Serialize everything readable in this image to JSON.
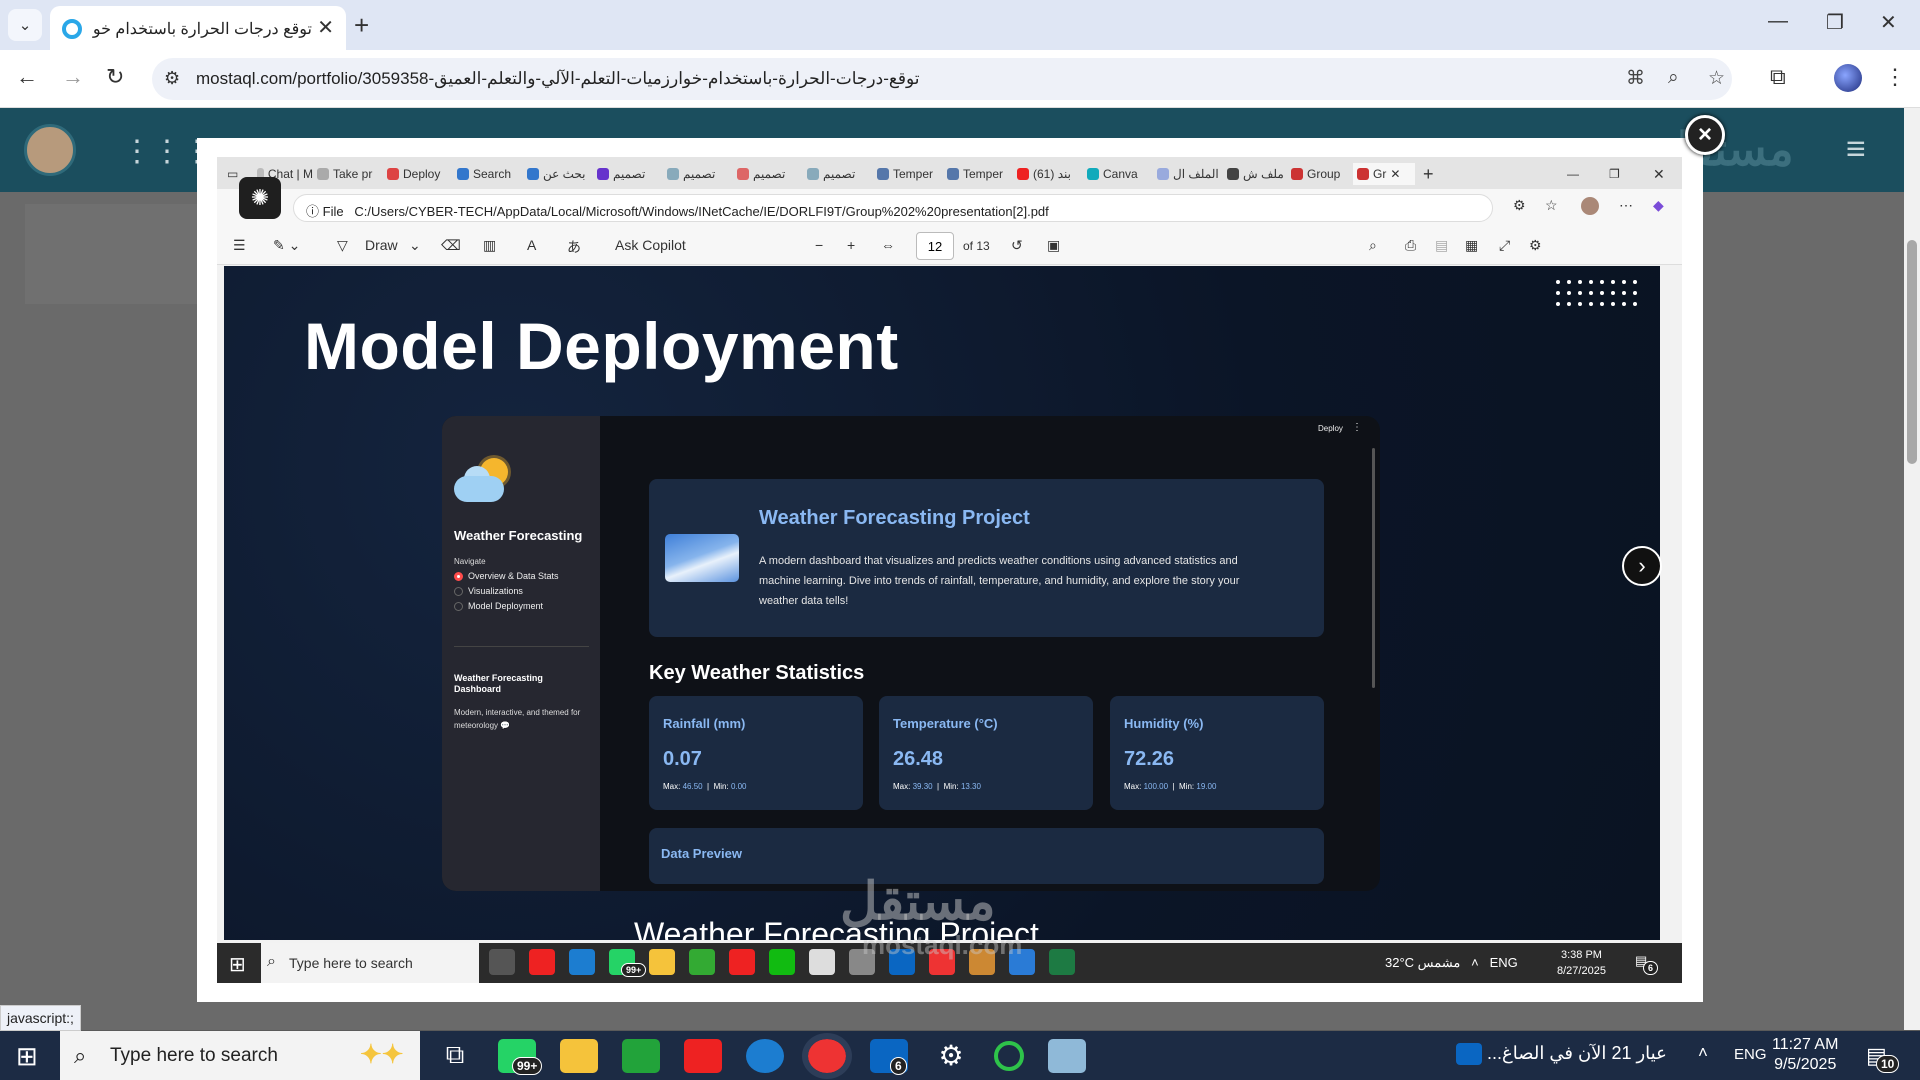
{
  "browser": {
    "tab_title": "توقع درجات الحرارة باستخدام خوارزميات",
    "url": "mostaql.com/portfolio/3059358-توقع-درجات-الحرارة-باستخدام-خوارزميات-التعلم-الآلي-والتعلم-العميق",
    "status_text": "javascript:;"
  },
  "modal": {
    "close_label": "×"
  },
  "inner_browser": {
    "tabs": [
      "Chat | M",
      "Take pr",
      "Deploy",
      "Search",
      "بحث عن",
      "تصميم",
      "تصميم",
      "تصميم",
      "تصميم",
      "Temper",
      "Temper",
      "(61) بند",
      "Canva",
      "الملف ال",
      "ملف ش",
      "Group",
      "Gr"
    ],
    "url_prefix": "File",
    "url": "C:/Users/CYBER-TECH/AppData/Local/Microsoft/Windows/INetCache/IE/DORLFI9T/Group%202%20presentation[2].pdf",
    "pdf_toolbar": {
      "draw": "Draw",
      "ask_copilot": "Ask Copilot",
      "page": "12",
      "of": "of 13"
    }
  },
  "slide": {
    "title": "Model Deployment",
    "bottom_text": "Weather Forecasting Project"
  },
  "app": {
    "deploy": "Deploy",
    "sidebar": {
      "title": "Weather Forecasting",
      "navigate": "Navigate",
      "options": [
        "Overview & Data Stats",
        "Visualizations",
        "Model Deployment"
      ],
      "selected": 0,
      "dashboard_title": "Weather Forecasting Dashboard",
      "dashboard_desc": "Modern, interactive, and themed for meteorology 💬"
    },
    "hero": {
      "title": "Weather Forecasting Project",
      "text": "A modern dashboard that visualizes and predicts weather conditions using advanced statistics and machine learning. Dive into trends of rainfall, temperature, and humidity, and explore the story your weather data tells!"
    },
    "stats_title": "Key Weather Statistics",
    "stats": [
      {
        "title": "Rainfall (mm)",
        "value": "0.07",
        "max_label": "Max:",
        "max": "46.50",
        "min_label": "Min:",
        "min": "0.00"
      },
      {
        "title": "Temperature (°C)",
        "value": "26.48",
        "max_label": "Max:",
        "max": "39.30",
        "min_label": "Min:",
        "min": "13.30"
      },
      {
        "title": "Humidity (%)",
        "value": "72.26",
        "max_label": "Max:",
        "max": "100.00",
        "min_label": "Min:",
        "min": "19.00"
      }
    ],
    "preview_title": "Data Preview"
  },
  "watermark": {
    "arabic": "مستقل",
    "latin": "mostaql.com"
  },
  "inner_taskbar": {
    "search": "Type here to search",
    "weather": "32°C مشمس",
    "lang": "ENG",
    "time": "3:38 PM",
    "date": "8/27/2025",
    "badge_whatsapp": "99+",
    "badge_notif": "6"
  },
  "taskbar": {
    "search": "Type here to search",
    "weather_text": "عيار 21 الآن في الصاغ...",
    "lang": "ENG",
    "time": "11:27 AM",
    "date": "9/5/2025",
    "badge_whatsapp": "99+",
    "badge_linkedin": "6",
    "badge_notif": "10"
  }
}
